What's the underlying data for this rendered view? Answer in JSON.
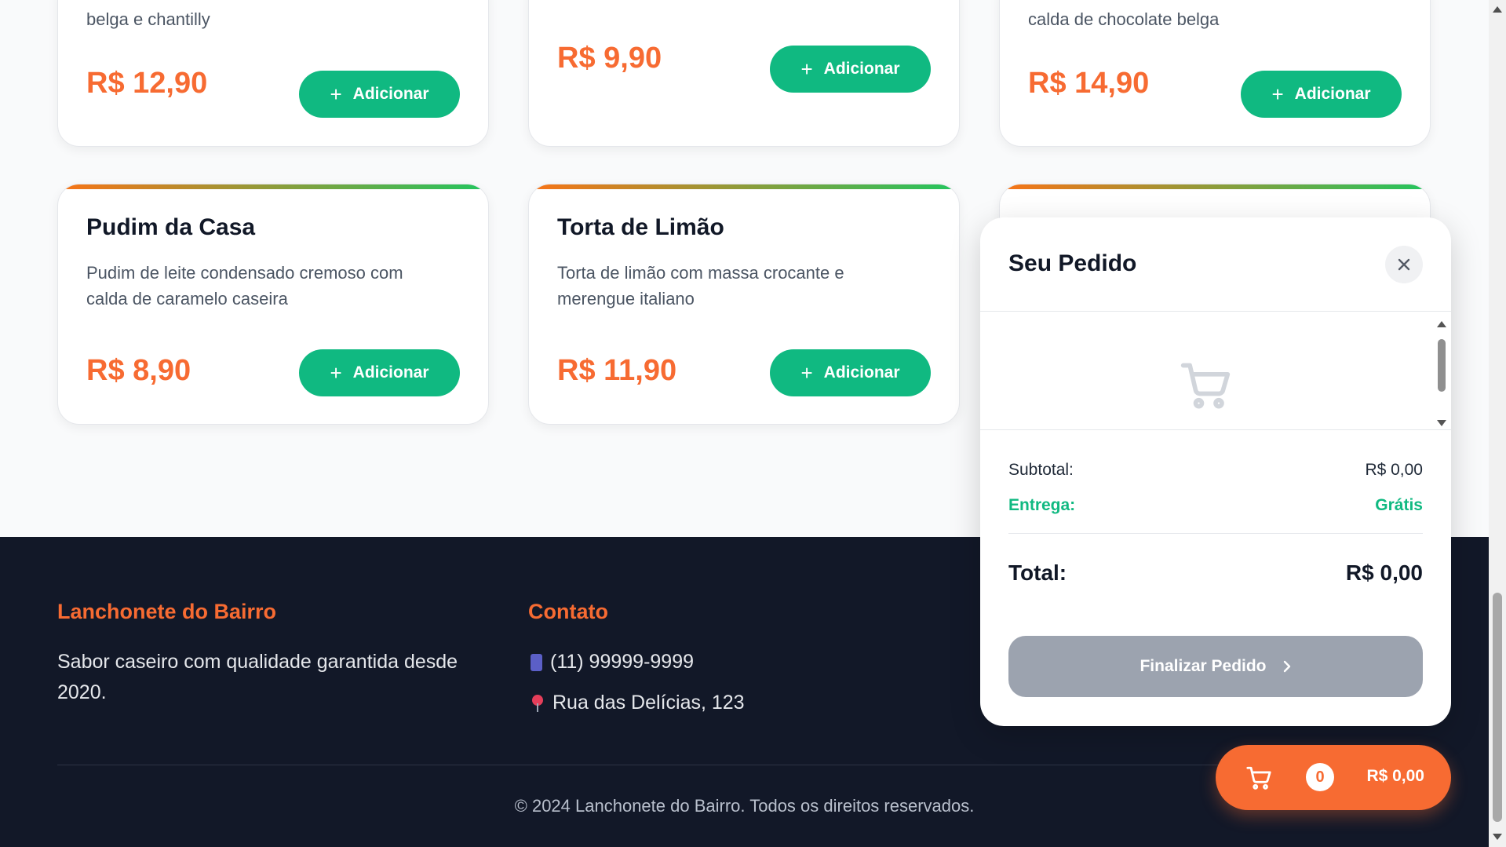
{
  "menu": {
    "add_label": "Adicionar",
    "cards_row1": [
      {
        "description_tail": "belga e chantilly",
        "price": "R$ 12,90"
      },
      {
        "price": "R$ 9,90"
      },
      {
        "description_tail": "calda de chocolate belga",
        "price": "R$ 14,90"
      }
    ],
    "cards_row2": [
      {
        "name": "Pudim da Casa",
        "description": "Pudim de leite condensado cremoso com calda de caramelo caseira",
        "price": "R$ 8,90"
      },
      {
        "name": "Torta de Limão",
        "description": "Torta de limão com massa crocante e merengue italiano",
        "price": "R$ 11,90"
      }
    ]
  },
  "footer": {
    "brand_title": "Lanchonete do Bairro",
    "brand_text": "Sabor caseiro com qualidade garantida desde 2020.",
    "contact_title": "Contato",
    "phone_icon": "phone-icon",
    "phone": "(11) 99999-9999",
    "address_icon": "pin-icon",
    "address": "Rua das Delícias, 123",
    "copyright": "© 2024 Lanchonete do Bairro. Todos os direitos reservados."
  },
  "cart_panel": {
    "title": "Seu Pedido",
    "empty_icon": "cart-icon",
    "subtotal_label": "Subtotal:",
    "subtotal_value": "R$ 0,00",
    "delivery_label": "Entrega:",
    "delivery_value": "Grátis",
    "total_label": "Total:",
    "total_value": "R$ 0,00",
    "finalize_label": "Finalizar Pedido"
  },
  "floating_cart": {
    "count": "0",
    "total": "R$ 0,00"
  },
  "colors": {
    "accent_orange": "#f76b32",
    "accent_green": "#10b981",
    "footer_bg": "#121828",
    "disabled_gray": "#9ca3af"
  }
}
